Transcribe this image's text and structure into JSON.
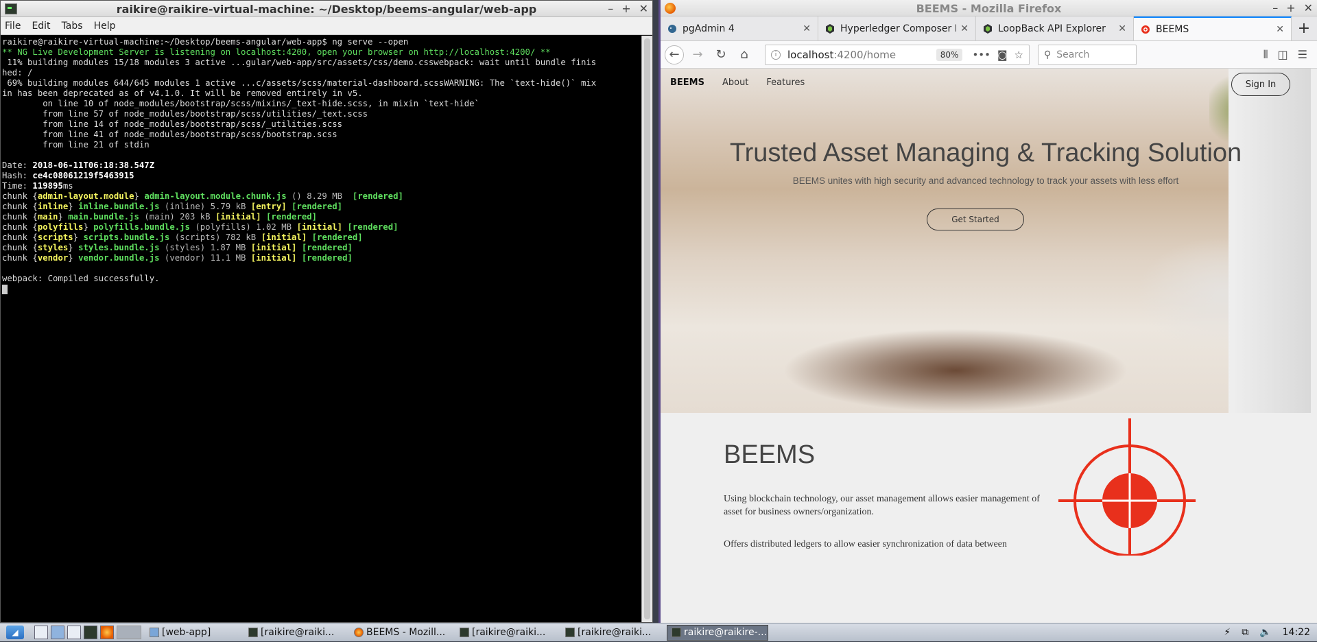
{
  "terminal": {
    "title": "raikire@raikire-virtual-machine: ~/Desktop/beems-angular/web-app",
    "menu": [
      "File",
      "Edit",
      "Tabs",
      "Help"
    ],
    "lines": {
      "l1": "raikire@raikire-virtual-machine:~/Desktop/beems-angular/web-app$ ng serve --open",
      "l2": "** NG Live Development Server is listening on localhost:4200, open your browser on http://localhost:4200/ **",
      "l3": " 11% building modules 15/18 modules 3 active ...gular/web-app/src/assets/css/demo.csswebpack: wait until bundle finis",
      "l4": "hed: /",
      "l5": " 69% building modules 644/645 modules 1 active ...c/assets/scss/material-dashboard.scssWARNING: The `text-hide()` mix",
      "l6": "in has been deprecated as of v4.1.0. It will be removed entirely in v5.",
      "l7": "        on line 10 of node_modules/bootstrap/scss/mixins/_text-hide.scss, in mixin `text-hide`",
      "l8": "        from line 57 of node_modules/bootstrap/scss/utilities/_text.scss",
      "l9": "        from line 14 of node_modules/bootstrap/scss/_utilities.scss",
      "l10": "        from line 41 of node_modules/bootstrap/scss/bootstrap.scss",
      "l11": "        from line 21 of stdin",
      "date_label": "Date: ",
      "date": "2018-06-11T06:18:38.547Z",
      "hash_label": "Hash: ",
      "hash": "ce4c08061219f5463915",
      "time_label": "Time: ",
      "time": "119895",
      "time_unit": "ms",
      "compiled": "webpack: Compiled successfully."
    },
    "chunks": [
      {
        "pre": "chunk {",
        "name": "admin-layout.module",
        "mid": "} ",
        "file": "admin-layout.module.chunk.js",
        "info": " () 8.29 MB  ",
        "tag": "",
        "rendered": "[rendered]"
      },
      {
        "pre": "chunk {",
        "name": "inline",
        "mid": "} ",
        "file": "inline.bundle.js",
        "info": " (inline) 5.79 kB ",
        "tag": "[entry] ",
        "rendered": "[rendered]"
      },
      {
        "pre": "chunk {",
        "name": "main",
        "mid": "} ",
        "file": "main.bundle.js",
        "info": " (main) 203 kB ",
        "tag": "[initial] ",
        "rendered": "[rendered]"
      },
      {
        "pre": "chunk {",
        "name": "polyfills",
        "mid": "} ",
        "file": "polyfills.bundle.js",
        "info": " (polyfills) 1.02 MB ",
        "tag": "[initial] ",
        "rendered": "[rendered]"
      },
      {
        "pre": "chunk {",
        "name": "scripts",
        "mid": "} ",
        "file": "scripts.bundle.js",
        "info": " (scripts) 782 kB ",
        "tag": "[initial] ",
        "rendered": "[rendered]"
      },
      {
        "pre": "chunk {",
        "name": "styles",
        "mid": "} ",
        "file": "styles.bundle.js",
        "info": " (styles) 1.87 MB ",
        "tag": "[initial] ",
        "rendered": "[rendered]"
      },
      {
        "pre": "chunk {",
        "name": "vendor",
        "mid": "} ",
        "file": "vendor.bundle.js",
        "info": " (vendor) 11.1 MB ",
        "tag": "[initial] ",
        "rendered": "[rendered]"
      }
    ]
  },
  "firefox": {
    "title": "BEEMS - Mozilla Firefox",
    "tabs": [
      {
        "label": "pgAdmin 4",
        "icon": "elephant-icon",
        "active": false
      },
      {
        "label": "Hyperledger Composer Playground",
        "icon": "hyperledger-icon",
        "active": false
      },
      {
        "label": "LoopBack API Explorer",
        "icon": "loopback-icon",
        "active": false
      },
      {
        "label": "BEEMS",
        "icon": "beems-icon",
        "active": true
      }
    ],
    "url_host": "localhost",
    "url_path": ":4200/home",
    "zoom": "80%",
    "search_placeholder": "Search"
  },
  "page": {
    "nav": {
      "brand": "BEEMS",
      "about": "About",
      "features": "Features",
      "signin": "Sign In"
    },
    "hero_title": "Trusted Asset Managing & Tracking Solution",
    "hero_subtitle": "BEEMS unites with high security and advanced technology to track your assets with less effort",
    "cta": "Get Started",
    "section_title": "BEEMS",
    "section_p1": "Using blockchain technology, our asset management allows easier management of asset for business owners/organization.",
    "section_p2": "Offers distributed ledgers to allow easier synchronization of data between"
  },
  "taskbar": {
    "tasks": [
      "[web-app]",
      "[raikire@raiki...",
      "BEEMS - Mozill...",
      "[raikire@raiki...",
      "[raikire@raiki...",
      "raikire@raikire-..."
    ],
    "clock": "14:22"
  },
  "colors": {
    "accent": "#0a84ff",
    "terminal_green": "#5fdf5f",
    "terminal_yellow": "#f5f55f",
    "target_red": "#e8301c"
  }
}
